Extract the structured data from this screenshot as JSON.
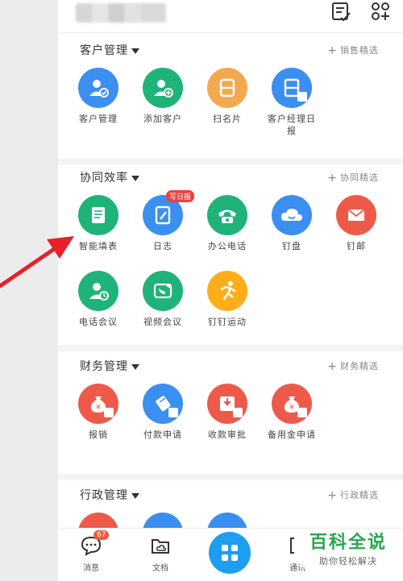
{
  "sections": {
    "customer": {
      "title": "客户管理",
      "link": "销售精选",
      "apps": [
        "客户管理",
        "添加客户",
        "扫名片",
        "客户经理日报"
      ]
    },
    "collab": {
      "title": "协同效率",
      "link": "协同精选",
      "apps": [
        "智能填表",
        "日志",
        "办公电话",
        "钉盘",
        "钉邮",
        "电话会议",
        "视频会议",
        "钉钉运动"
      ],
      "log_badge": "写日报"
    },
    "finance": {
      "title": "财务管理",
      "link": "财务精选",
      "apps": [
        "报销",
        "付款申请",
        "收款审批",
        "备用金申请"
      ]
    },
    "admin": {
      "title": "行政管理",
      "link": "行政精选"
    }
  },
  "bottom_nav": {
    "messages_label": "消息",
    "messages_count": "67",
    "docs_label": "文档",
    "right_label": "通讯"
  },
  "watermark": {
    "title": "百科全说",
    "subtitle": "助你轻松解决"
  },
  "colors": {
    "blue": "#3a8ff0",
    "green": "#1fb37a",
    "orange": "#f3a94f",
    "red": "#ee5a4a",
    "yellow": "#ffad1a",
    "arrow": "#e8202a"
  }
}
